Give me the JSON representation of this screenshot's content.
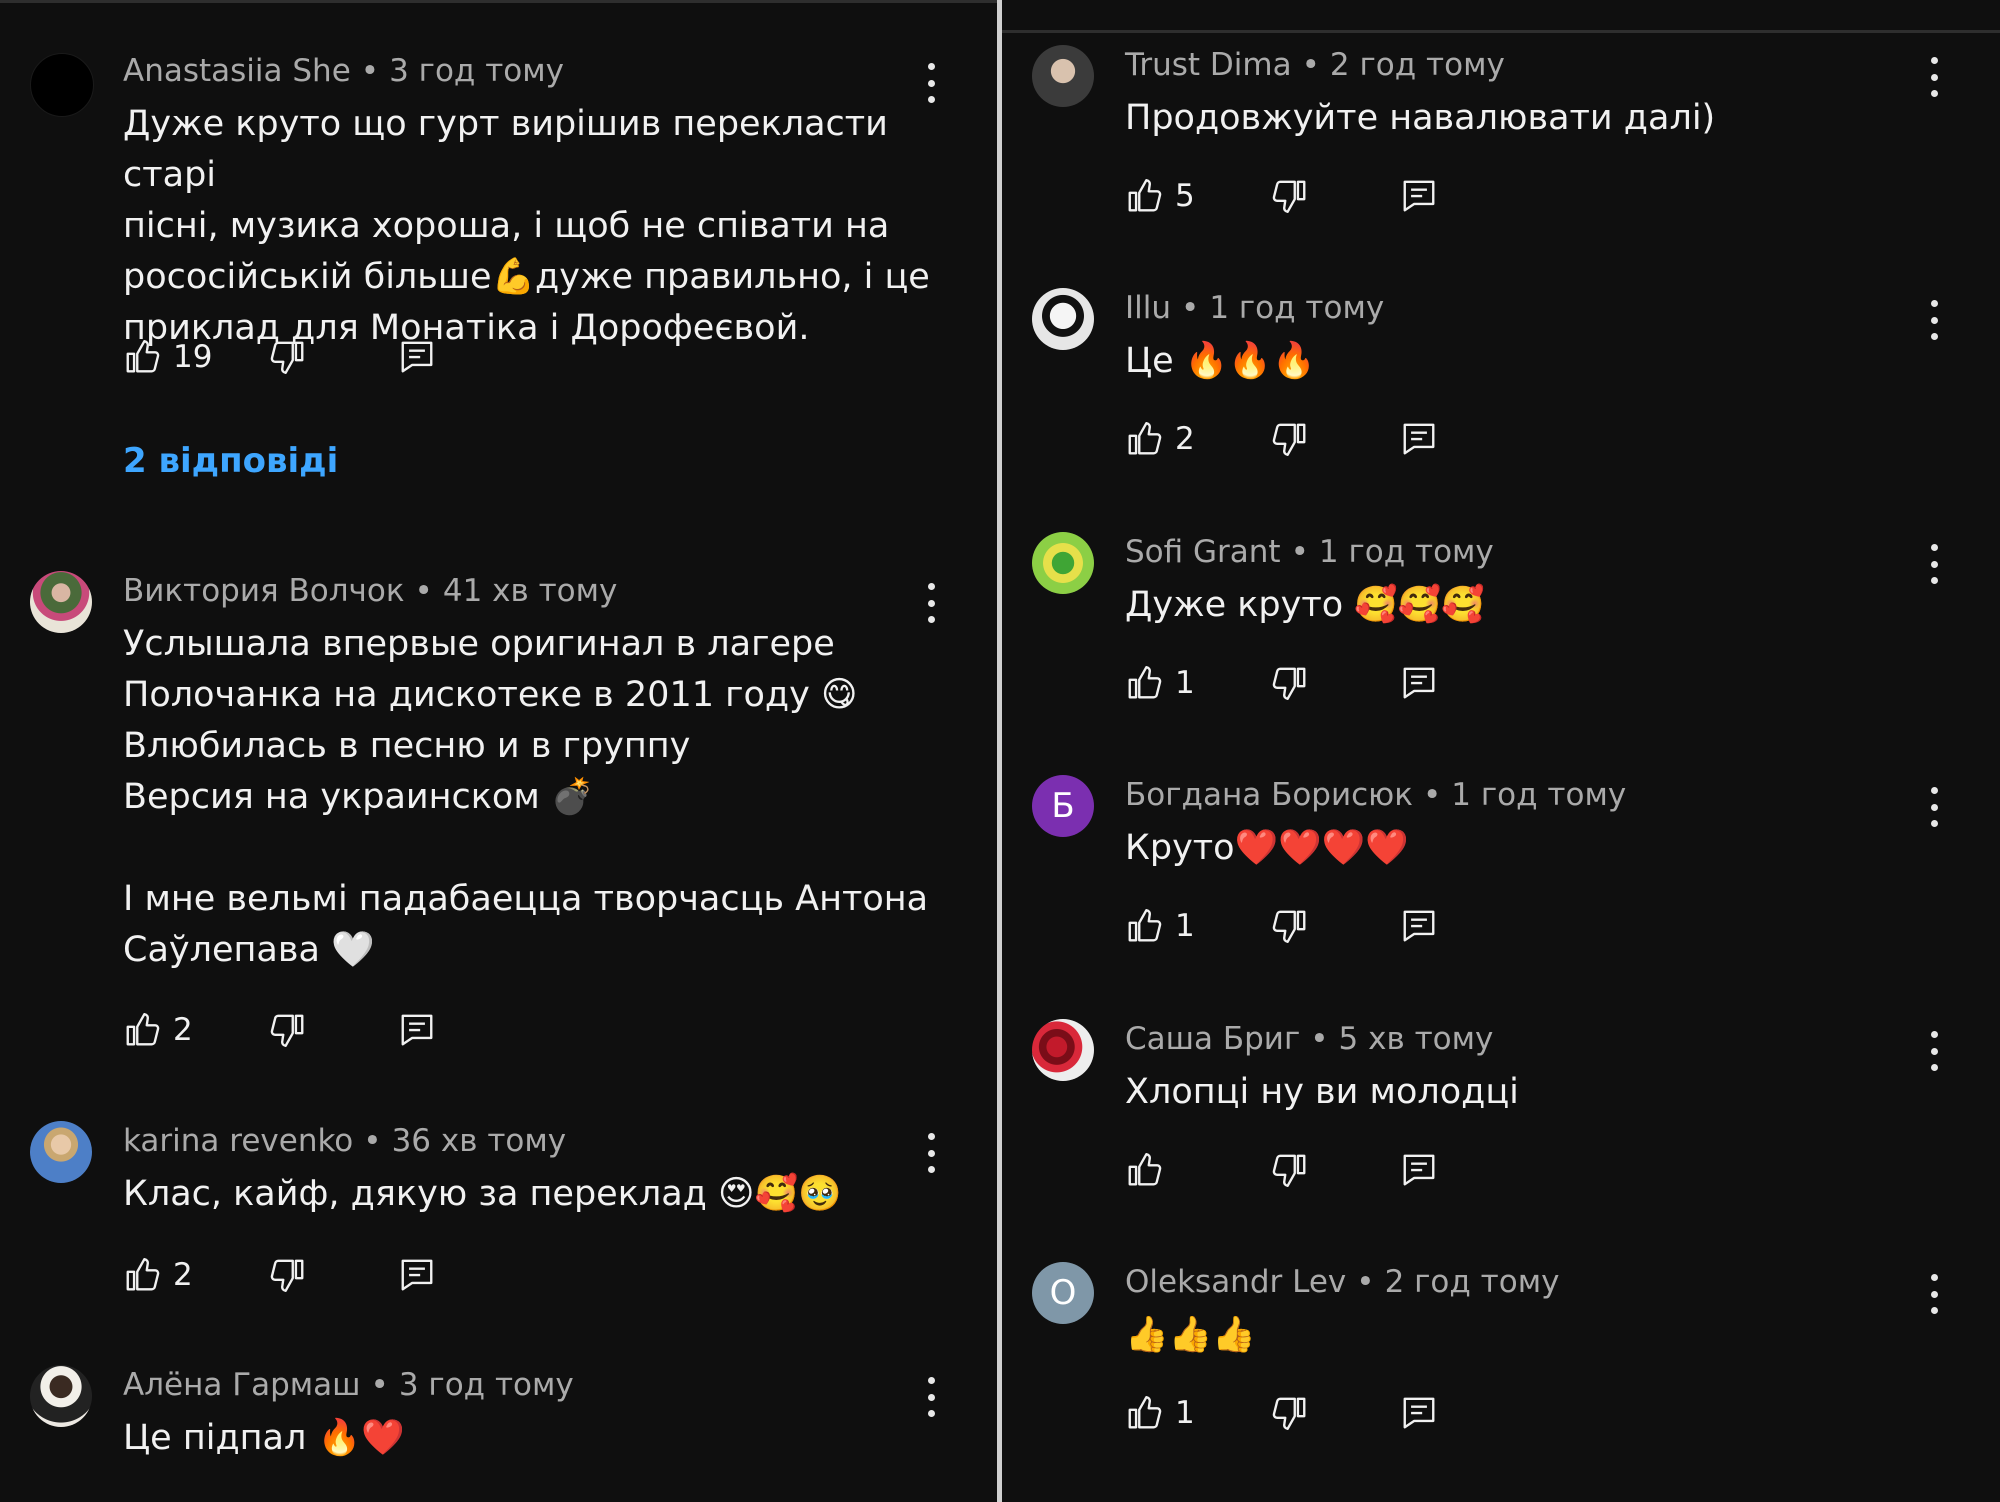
{
  "left": {
    "comments": [
      {
        "author": "Anastasiia She",
        "time": "3 год тому",
        "lines": [
          "Дуже круто що гурт вирішив перекласти старі",
          "пісні, музика хороша, і щоб не співати на",
          "рососійській більше💪дуже правильно, і це",
          "приклад для Монатіка і Дорофеєвой."
        ],
        "likes": "19",
        "replies": "2 відповіді"
      },
      {
        "author": "Виктория Волчок",
        "time": "41 хв тому",
        "lines": [
          "Услышала впервые оригинал в лагере",
          "Полочанка на дискотеке в 2011 году 😋",
          "Влюбилась в песню и в группу",
          "Версия на украинском 💣",
          "",
          "І мне вельмі падабаецца творчасць Антона",
          "Саўлепава 🤍"
        ],
        "likes": "2"
      },
      {
        "author": "karina revenko",
        "time": "36 хв тому",
        "lines": [
          "Клас, кайф, дякую за переклад 😍🥰🥹"
        ],
        "likes": "2"
      },
      {
        "author": "Алёна Гармаш",
        "time": "3 год тому",
        "lines": [
          "Це підпал 🔥❤️"
        ],
        "likes": ""
      }
    ]
  },
  "right": {
    "comments": [
      {
        "author": "Trust Dima",
        "time": "2 год тому",
        "lines": [
          "Продовжуйте навалювати далі)"
        ],
        "likes": "5"
      },
      {
        "author": "Illu",
        "time": "1 год тому",
        "lines": [
          "Це 🔥🔥🔥"
        ],
        "likes": "2"
      },
      {
        "author": "Sofi Grant",
        "time": "1 год тому",
        "lines": [
          "Дуже круто 🥰🥰🥰"
        ],
        "likes": "1"
      },
      {
        "author": "Богдана Борисюк",
        "time": "1 год тому",
        "lines": [
          "Круто❤️❤️❤️❤️"
        ],
        "likes": "1",
        "initial": "Б"
      },
      {
        "author": "Саша Бриг",
        "time": "5 хв тому",
        "lines": [
          "Хлопці ну ви молодці"
        ],
        "likes": ""
      },
      {
        "author": "Oleksandr Lev",
        "time": "2 год тому",
        "lines": [
          "👍👍👍"
        ],
        "likes": "1",
        "initial": "O"
      }
    ]
  },
  "icons": {
    "like": "thumb-up-icon",
    "dislike": "thumb-down-icon",
    "reply": "reply-comment-icon",
    "menu": "more-vert-icon"
  },
  "colors": {
    "background": "#0f0f0f",
    "text": "#f1f1f1",
    "meta": "#aaaaaa",
    "link": "#3ea6ff",
    "avatar_bogdana": "#7b2fb0",
    "avatar_oleksandr": "#7f97a8"
  }
}
